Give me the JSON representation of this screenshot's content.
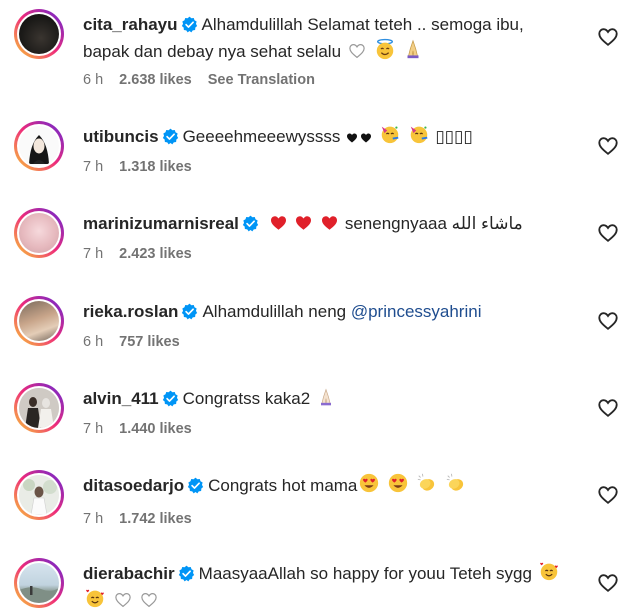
{
  "colors": {
    "meta": "#737373",
    "text": "#262626",
    "mention": "#1f4d8f",
    "verified": "#0095f6",
    "heart_red": "#e0202a"
  },
  "comments": [
    {
      "username": "cita_rahayu",
      "line1": "Alhamdulillah Selamat teteh .. semoga ibu,",
      "line2": "bapak dan debay nya sehat selalu",
      "time": "6 h",
      "likes": "2.638 likes",
      "translation": "See Translation",
      "emojis": [
        "white-heart",
        "smiling-face-with-halo",
        "folded-hands"
      ]
    },
    {
      "username": "utibuncis",
      "text": "Geeeehmeeewyssss",
      "tail": "▯▯▯▯",
      "time": "7 h",
      "likes": "1.318 likes",
      "emojis": [
        "black-heart",
        "black-heart",
        "partying-face",
        "partying-face"
      ]
    },
    {
      "username": "marinizumarnisreal",
      "text": "senengnyaaa",
      "arabic": "ماشاء الله",
      "time": "7 h",
      "likes": "2.423 likes",
      "emojis": [
        "red-heart",
        "red-heart",
        "red-heart"
      ]
    },
    {
      "username": "rieka.roslan",
      "text": "Alhamdulillah neng",
      "mention": "@princessyahrini",
      "time": "6 h",
      "likes": "757 likes"
    },
    {
      "username": "alvin_411",
      "text": "Congratss kaka2",
      "time": "7 h",
      "likes": "1.440 likes",
      "emojis": [
        "folded-hands"
      ]
    },
    {
      "username": "ditasoedarjo",
      "text": "Congrats hot mama",
      "time": "7 h",
      "likes": "1.742 likes",
      "emojis": [
        "heart-eyes-face",
        "heart-eyes-face",
        "clapping-hands",
        "clapping-hands"
      ]
    },
    {
      "username": "dierabachir",
      "text": "MaasyaaAllah so happy for youu Teteh sygg",
      "emojis": [
        "smiling-face-with-hearts",
        "smiling-face-with-hearts",
        "white-heart",
        "white-heart"
      ]
    }
  ]
}
